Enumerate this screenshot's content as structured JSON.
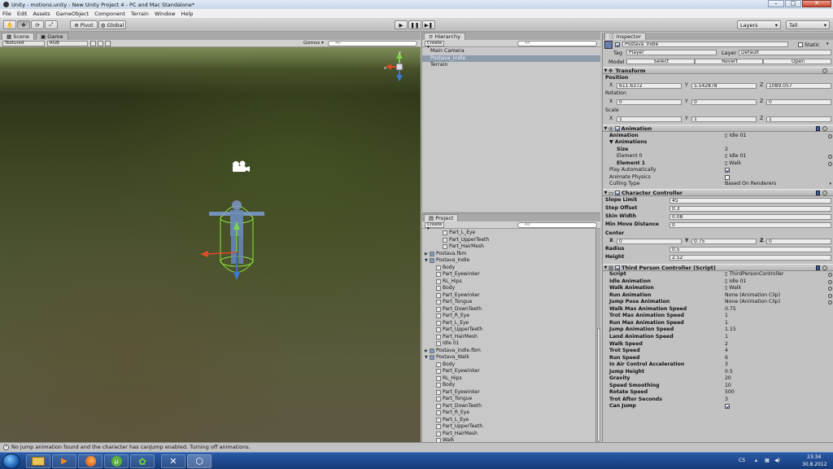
{
  "window": {
    "title": "Unity - motions.unity - New Unity Project 4 - PC and Mac Standalone*"
  },
  "menu": [
    "File",
    "Edit",
    "Assets",
    "GameObject",
    "Component",
    "Terrain",
    "Window",
    "Help"
  ],
  "toolbar": {
    "pivot": "Pivot",
    "global": "Global",
    "layers": "Layers",
    "layout": "Tall"
  },
  "scene": {
    "tabs": [
      "Scene",
      "Game"
    ],
    "shading": "Textured",
    "render_mode": "RGB",
    "gizmos": "Gizmos",
    "search_placeholder": "All"
  },
  "hierarchy": {
    "tab": "Hierarchy",
    "create": "Create",
    "search_placeholder": "All",
    "items": [
      "Main Camera",
      "Postava_Indle",
      "Terrain"
    ]
  },
  "project": {
    "tab": "Project",
    "create": "Create",
    "search_placeholder": "All",
    "items": [
      {
        "label": "Part_L_Eye",
        "depth": 2,
        "arrow": ""
      },
      {
        "label": "Part_UpperTeeth",
        "depth": 2,
        "arrow": ""
      },
      {
        "label": "Part_HairMesh",
        "depth": 2,
        "arrow": ""
      },
      {
        "label": "Postava.fbm",
        "depth": 0,
        "arrow": "▶"
      },
      {
        "label": "Postava_Indle",
        "depth": 0,
        "arrow": "▼"
      },
      {
        "label": "Body",
        "depth": 1,
        "arrow": ""
      },
      {
        "label": "Part_Eyewinker",
        "depth": 1,
        "arrow": ""
      },
      {
        "label": "RL_Hips",
        "depth": 1,
        "arrow": ""
      },
      {
        "label": "Body",
        "depth": 1,
        "arrow": ""
      },
      {
        "label": "Part_Eyewinker",
        "depth": 1,
        "arrow": ""
      },
      {
        "label": "Part_Tongue",
        "depth": 1,
        "arrow": ""
      },
      {
        "label": "Part_DownTeeth",
        "depth": 1,
        "arrow": ""
      },
      {
        "label": "Part_R_Eye",
        "depth": 1,
        "arrow": ""
      },
      {
        "label": "Part_L_Eye",
        "depth": 1,
        "arrow": ""
      },
      {
        "label": "Part_UpperTeeth",
        "depth": 1,
        "arrow": ""
      },
      {
        "label": "Part_HairMesh",
        "depth": 1,
        "arrow": ""
      },
      {
        "label": "Idle 01",
        "depth": 1,
        "arrow": ""
      },
      {
        "label": "Postava_Indle.fbm",
        "depth": 0,
        "arrow": "▶"
      },
      {
        "label": "Postava_Walk",
        "depth": 0,
        "arrow": "▼"
      },
      {
        "label": "Body",
        "depth": 1,
        "arrow": ""
      },
      {
        "label": "Part_Eyewinker",
        "depth": 1,
        "arrow": ""
      },
      {
        "label": "RL_Hips",
        "depth": 1,
        "arrow": ""
      },
      {
        "label": "Body",
        "depth": 1,
        "arrow": ""
      },
      {
        "label": "Part_Eyewinker",
        "depth": 1,
        "arrow": ""
      },
      {
        "label": "Part_Tongue",
        "depth": 1,
        "arrow": ""
      },
      {
        "label": "Part_DownTeeth",
        "depth": 1,
        "arrow": ""
      },
      {
        "label": "Part_R_Eye",
        "depth": 1,
        "arrow": ""
      },
      {
        "label": "Part_L_Eye",
        "depth": 1,
        "arrow": ""
      },
      {
        "label": "Part_UpperTeeth",
        "depth": 1,
        "arrow": ""
      },
      {
        "label": "Part_HairMesh",
        "depth": 1,
        "arrow": ""
      },
      {
        "label": "Walk",
        "depth": 1,
        "arrow": ""
      }
    ]
  },
  "inspector": {
    "tab": "Inspector",
    "object_name": "Postava_Indle",
    "static": "Static",
    "tag_label": "Tag",
    "tag": "Player",
    "layer_label": "Layer",
    "layer": "Default",
    "model_label": "Model",
    "select": "Select",
    "revert": "Revert",
    "open": "Open",
    "transform": {
      "title": "Transform",
      "position": "Position",
      "px": "611.6372",
      "py": "5.542878",
      "pz": "1089.057",
      "rotation": "Rotation",
      "rx": "0",
      "ry": "0",
      "rz": "0",
      "scale": "Scale",
      "sx": "1",
      "sy": "1",
      "sz": "1"
    },
    "animation": {
      "title": "Animation",
      "animation_label": "Animation",
      "animation_value": "Idle 01",
      "animations_label": "Animations",
      "size_label": "Size",
      "size_value": "2",
      "el0_label": "Element 0",
      "el0_value": "Idle 01",
      "el1_label": "Element 1",
      "el1_value": "Walk",
      "play_auto": "Play Automatically",
      "animate_physics": "Animate Physics",
      "culling_label": "Culling Type",
      "culling_value": "Based On Renderers"
    },
    "cc": {
      "title": "Character Controller",
      "rows": [
        {
          "label": "Slope Limit",
          "value": "45"
        },
        {
          "label": "Step Offset",
          "value": "0.3"
        },
        {
          "label": "Skin Width",
          "value": "0.08"
        },
        {
          "label": "Min Move Distance",
          "value": "0"
        }
      ],
      "center": "Center",
      "cx": "0",
      "cy": "0.75",
      "cz": "0",
      "radius_label": "Radius",
      "radius": "0.5",
      "height_label": "Height",
      "height": "2.52"
    },
    "tpc": {
      "title": "Third Person Controller (Script)",
      "rows": [
        {
          "label": "Script",
          "value": "ThirdPersonController"
        },
        {
          "label": "Idle Animation",
          "value": "Idle 01"
        },
        {
          "label": "Walk Animation",
          "value": "Walk"
        },
        {
          "label": "Run Animation",
          "value": "None (Animation Clip)"
        },
        {
          "label": "Jump Pose Animation",
          "value": "None (Animation Clip)"
        },
        {
          "label": "Walk Max Animation Speed",
          "value": "0.75"
        },
        {
          "label": "Trot Max Animation Speed",
          "value": "1"
        },
        {
          "label": "Run Max Animation Speed",
          "value": "1"
        },
        {
          "label": "Jump Animation Speed",
          "value": "1.15"
        },
        {
          "label": "Land Animation Speed",
          "value": "1"
        },
        {
          "label": "Walk Speed",
          "value": "2"
        },
        {
          "label": "Trot Speed",
          "value": "4"
        },
        {
          "label": "Run Speed",
          "value": "6"
        },
        {
          "label": "In Air Control Acceleration",
          "value": "3"
        },
        {
          "label": "Jump Height",
          "value": "0.5"
        },
        {
          "label": "Gravity",
          "value": "20"
        },
        {
          "label": "Speed Smoothing",
          "value": "10"
        },
        {
          "label": "Rotate Speed",
          "value": "500"
        },
        {
          "label": "Trot After Seconds",
          "value": "3"
        },
        {
          "label": "Can Jump",
          "value": ""
        }
      ]
    }
  },
  "status": {
    "message": "No jump animation found and the character has canJump enabled. Turning off animations."
  },
  "taskbar": {
    "lang": "CS",
    "time": "23:34",
    "date": "30.8.2012"
  }
}
